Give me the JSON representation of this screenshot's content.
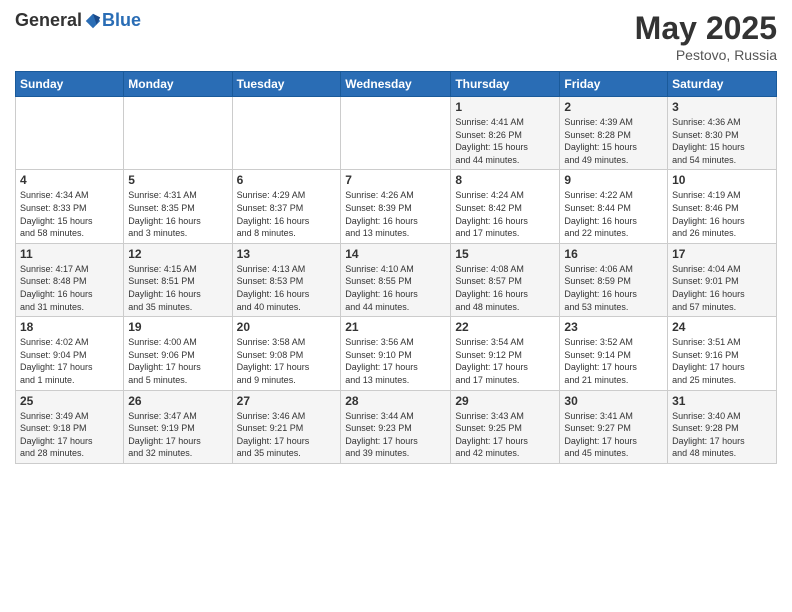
{
  "header": {
    "logo_general": "General",
    "logo_blue": "Blue",
    "title": "May 2025",
    "location": "Pestovo, Russia"
  },
  "days_of_week": [
    "Sunday",
    "Monday",
    "Tuesday",
    "Wednesday",
    "Thursday",
    "Friday",
    "Saturday"
  ],
  "weeks": [
    [
      {
        "day": "",
        "info": ""
      },
      {
        "day": "",
        "info": ""
      },
      {
        "day": "",
        "info": ""
      },
      {
        "day": "",
        "info": ""
      },
      {
        "day": "1",
        "info": "Sunrise: 4:41 AM\nSunset: 8:26 PM\nDaylight: 15 hours\nand 44 minutes."
      },
      {
        "day": "2",
        "info": "Sunrise: 4:39 AM\nSunset: 8:28 PM\nDaylight: 15 hours\nand 49 minutes."
      },
      {
        "day": "3",
        "info": "Sunrise: 4:36 AM\nSunset: 8:30 PM\nDaylight: 15 hours\nand 54 minutes."
      }
    ],
    [
      {
        "day": "4",
        "info": "Sunrise: 4:34 AM\nSunset: 8:33 PM\nDaylight: 15 hours\nand 58 minutes."
      },
      {
        "day": "5",
        "info": "Sunrise: 4:31 AM\nSunset: 8:35 PM\nDaylight: 16 hours\nand 3 minutes."
      },
      {
        "day": "6",
        "info": "Sunrise: 4:29 AM\nSunset: 8:37 PM\nDaylight: 16 hours\nand 8 minutes."
      },
      {
        "day": "7",
        "info": "Sunrise: 4:26 AM\nSunset: 8:39 PM\nDaylight: 16 hours\nand 13 minutes."
      },
      {
        "day": "8",
        "info": "Sunrise: 4:24 AM\nSunset: 8:42 PM\nDaylight: 16 hours\nand 17 minutes."
      },
      {
        "day": "9",
        "info": "Sunrise: 4:22 AM\nSunset: 8:44 PM\nDaylight: 16 hours\nand 22 minutes."
      },
      {
        "day": "10",
        "info": "Sunrise: 4:19 AM\nSunset: 8:46 PM\nDaylight: 16 hours\nand 26 minutes."
      }
    ],
    [
      {
        "day": "11",
        "info": "Sunrise: 4:17 AM\nSunset: 8:48 PM\nDaylight: 16 hours\nand 31 minutes."
      },
      {
        "day": "12",
        "info": "Sunrise: 4:15 AM\nSunset: 8:51 PM\nDaylight: 16 hours\nand 35 minutes."
      },
      {
        "day": "13",
        "info": "Sunrise: 4:13 AM\nSunset: 8:53 PM\nDaylight: 16 hours\nand 40 minutes."
      },
      {
        "day": "14",
        "info": "Sunrise: 4:10 AM\nSunset: 8:55 PM\nDaylight: 16 hours\nand 44 minutes."
      },
      {
        "day": "15",
        "info": "Sunrise: 4:08 AM\nSunset: 8:57 PM\nDaylight: 16 hours\nand 48 minutes."
      },
      {
        "day": "16",
        "info": "Sunrise: 4:06 AM\nSunset: 8:59 PM\nDaylight: 16 hours\nand 53 minutes."
      },
      {
        "day": "17",
        "info": "Sunrise: 4:04 AM\nSunset: 9:01 PM\nDaylight: 16 hours\nand 57 minutes."
      }
    ],
    [
      {
        "day": "18",
        "info": "Sunrise: 4:02 AM\nSunset: 9:04 PM\nDaylight: 17 hours\nand 1 minute."
      },
      {
        "day": "19",
        "info": "Sunrise: 4:00 AM\nSunset: 9:06 PM\nDaylight: 17 hours\nand 5 minutes."
      },
      {
        "day": "20",
        "info": "Sunrise: 3:58 AM\nSunset: 9:08 PM\nDaylight: 17 hours\nand 9 minutes."
      },
      {
        "day": "21",
        "info": "Sunrise: 3:56 AM\nSunset: 9:10 PM\nDaylight: 17 hours\nand 13 minutes."
      },
      {
        "day": "22",
        "info": "Sunrise: 3:54 AM\nSunset: 9:12 PM\nDaylight: 17 hours\nand 17 minutes."
      },
      {
        "day": "23",
        "info": "Sunrise: 3:52 AM\nSunset: 9:14 PM\nDaylight: 17 hours\nand 21 minutes."
      },
      {
        "day": "24",
        "info": "Sunrise: 3:51 AM\nSunset: 9:16 PM\nDaylight: 17 hours\nand 25 minutes."
      }
    ],
    [
      {
        "day": "25",
        "info": "Sunrise: 3:49 AM\nSunset: 9:18 PM\nDaylight: 17 hours\nand 28 minutes."
      },
      {
        "day": "26",
        "info": "Sunrise: 3:47 AM\nSunset: 9:19 PM\nDaylight: 17 hours\nand 32 minutes."
      },
      {
        "day": "27",
        "info": "Sunrise: 3:46 AM\nSunset: 9:21 PM\nDaylight: 17 hours\nand 35 minutes."
      },
      {
        "day": "28",
        "info": "Sunrise: 3:44 AM\nSunset: 9:23 PM\nDaylight: 17 hours\nand 39 minutes."
      },
      {
        "day": "29",
        "info": "Sunrise: 3:43 AM\nSunset: 9:25 PM\nDaylight: 17 hours\nand 42 minutes."
      },
      {
        "day": "30",
        "info": "Sunrise: 3:41 AM\nSunset: 9:27 PM\nDaylight: 17 hours\nand 45 minutes."
      },
      {
        "day": "31",
        "info": "Sunrise: 3:40 AM\nSunset: 9:28 PM\nDaylight: 17 hours\nand 48 minutes."
      }
    ]
  ]
}
